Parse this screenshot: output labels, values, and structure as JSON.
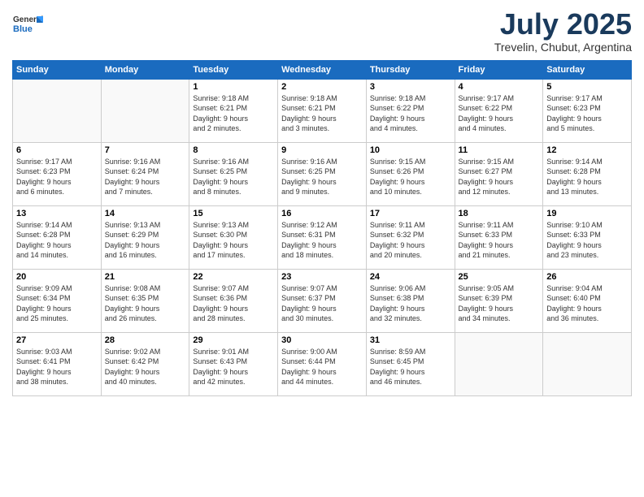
{
  "logo": {
    "general": "General",
    "blue": "Blue"
  },
  "header": {
    "month": "July 2025",
    "location": "Trevelin, Chubut, Argentina"
  },
  "days_of_week": [
    "Sunday",
    "Monday",
    "Tuesday",
    "Wednesday",
    "Thursday",
    "Friday",
    "Saturday"
  ],
  "weeks": [
    [
      {
        "day": "",
        "info": ""
      },
      {
        "day": "",
        "info": ""
      },
      {
        "day": "1",
        "info": "Sunrise: 9:18 AM\nSunset: 6:21 PM\nDaylight: 9 hours\nand 2 minutes."
      },
      {
        "day": "2",
        "info": "Sunrise: 9:18 AM\nSunset: 6:21 PM\nDaylight: 9 hours\nand 3 minutes."
      },
      {
        "day": "3",
        "info": "Sunrise: 9:18 AM\nSunset: 6:22 PM\nDaylight: 9 hours\nand 4 minutes."
      },
      {
        "day": "4",
        "info": "Sunrise: 9:17 AM\nSunset: 6:22 PM\nDaylight: 9 hours\nand 4 minutes."
      },
      {
        "day": "5",
        "info": "Sunrise: 9:17 AM\nSunset: 6:23 PM\nDaylight: 9 hours\nand 5 minutes."
      }
    ],
    [
      {
        "day": "6",
        "info": "Sunrise: 9:17 AM\nSunset: 6:23 PM\nDaylight: 9 hours\nand 6 minutes."
      },
      {
        "day": "7",
        "info": "Sunrise: 9:16 AM\nSunset: 6:24 PM\nDaylight: 9 hours\nand 7 minutes."
      },
      {
        "day": "8",
        "info": "Sunrise: 9:16 AM\nSunset: 6:25 PM\nDaylight: 9 hours\nand 8 minutes."
      },
      {
        "day": "9",
        "info": "Sunrise: 9:16 AM\nSunset: 6:25 PM\nDaylight: 9 hours\nand 9 minutes."
      },
      {
        "day": "10",
        "info": "Sunrise: 9:15 AM\nSunset: 6:26 PM\nDaylight: 9 hours\nand 10 minutes."
      },
      {
        "day": "11",
        "info": "Sunrise: 9:15 AM\nSunset: 6:27 PM\nDaylight: 9 hours\nand 12 minutes."
      },
      {
        "day": "12",
        "info": "Sunrise: 9:14 AM\nSunset: 6:28 PM\nDaylight: 9 hours\nand 13 minutes."
      }
    ],
    [
      {
        "day": "13",
        "info": "Sunrise: 9:14 AM\nSunset: 6:28 PM\nDaylight: 9 hours\nand 14 minutes."
      },
      {
        "day": "14",
        "info": "Sunrise: 9:13 AM\nSunset: 6:29 PM\nDaylight: 9 hours\nand 16 minutes."
      },
      {
        "day": "15",
        "info": "Sunrise: 9:13 AM\nSunset: 6:30 PM\nDaylight: 9 hours\nand 17 minutes."
      },
      {
        "day": "16",
        "info": "Sunrise: 9:12 AM\nSunset: 6:31 PM\nDaylight: 9 hours\nand 18 minutes."
      },
      {
        "day": "17",
        "info": "Sunrise: 9:11 AM\nSunset: 6:32 PM\nDaylight: 9 hours\nand 20 minutes."
      },
      {
        "day": "18",
        "info": "Sunrise: 9:11 AM\nSunset: 6:33 PM\nDaylight: 9 hours\nand 21 minutes."
      },
      {
        "day": "19",
        "info": "Sunrise: 9:10 AM\nSunset: 6:33 PM\nDaylight: 9 hours\nand 23 minutes."
      }
    ],
    [
      {
        "day": "20",
        "info": "Sunrise: 9:09 AM\nSunset: 6:34 PM\nDaylight: 9 hours\nand 25 minutes."
      },
      {
        "day": "21",
        "info": "Sunrise: 9:08 AM\nSunset: 6:35 PM\nDaylight: 9 hours\nand 26 minutes."
      },
      {
        "day": "22",
        "info": "Sunrise: 9:07 AM\nSunset: 6:36 PM\nDaylight: 9 hours\nand 28 minutes."
      },
      {
        "day": "23",
        "info": "Sunrise: 9:07 AM\nSunset: 6:37 PM\nDaylight: 9 hours\nand 30 minutes."
      },
      {
        "day": "24",
        "info": "Sunrise: 9:06 AM\nSunset: 6:38 PM\nDaylight: 9 hours\nand 32 minutes."
      },
      {
        "day": "25",
        "info": "Sunrise: 9:05 AM\nSunset: 6:39 PM\nDaylight: 9 hours\nand 34 minutes."
      },
      {
        "day": "26",
        "info": "Sunrise: 9:04 AM\nSunset: 6:40 PM\nDaylight: 9 hours\nand 36 minutes."
      }
    ],
    [
      {
        "day": "27",
        "info": "Sunrise: 9:03 AM\nSunset: 6:41 PM\nDaylight: 9 hours\nand 38 minutes."
      },
      {
        "day": "28",
        "info": "Sunrise: 9:02 AM\nSunset: 6:42 PM\nDaylight: 9 hours\nand 40 minutes."
      },
      {
        "day": "29",
        "info": "Sunrise: 9:01 AM\nSunset: 6:43 PM\nDaylight: 9 hours\nand 42 minutes."
      },
      {
        "day": "30",
        "info": "Sunrise: 9:00 AM\nSunset: 6:44 PM\nDaylight: 9 hours\nand 44 minutes."
      },
      {
        "day": "31",
        "info": "Sunrise: 8:59 AM\nSunset: 6:45 PM\nDaylight: 9 hours\nand 46 minutes."
      },
      {
        "day": "",
        "info": ""
      },
      {
        "day": "",
        "info": ""
      }
    ]
  ]
}
